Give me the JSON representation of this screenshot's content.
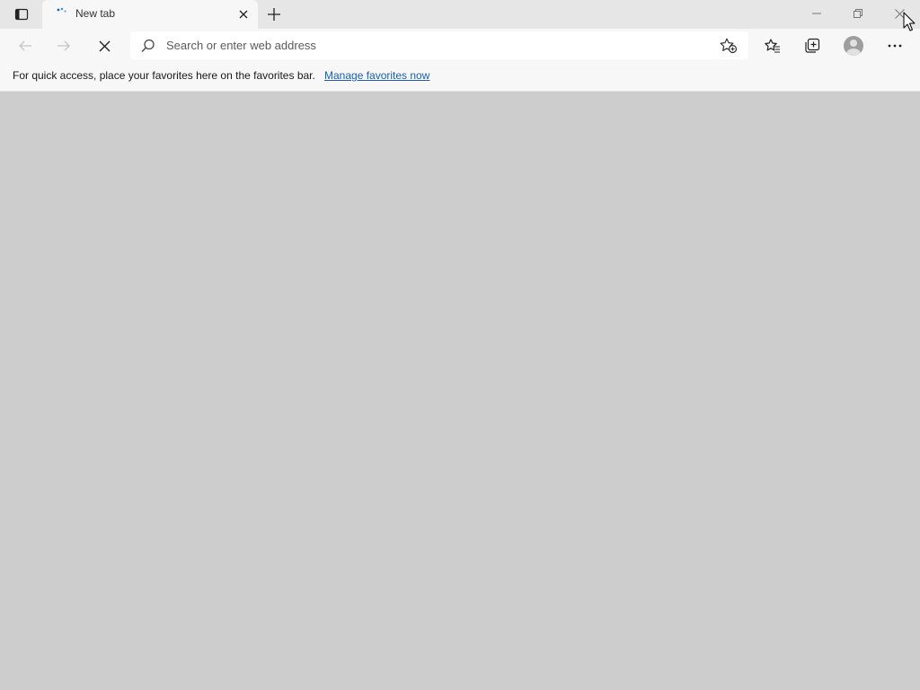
{
  "tab": {
    "title": "New tab"
  },
  "toolbar": {
    "address_placeholder": "Search or enter web address"
  },
  "favorites_bar": {
    "message": "For quick access, place your favorites here on the favorites bar.",
    "link_label": "Manage favorites now"
  },
  "colors": {
    "titlebar": "#e6e6e6",
    "toolbar": "#f7f7f7",
    "content": "#cdcdcd",
    "link": "#1a5fb4"
  }
}
